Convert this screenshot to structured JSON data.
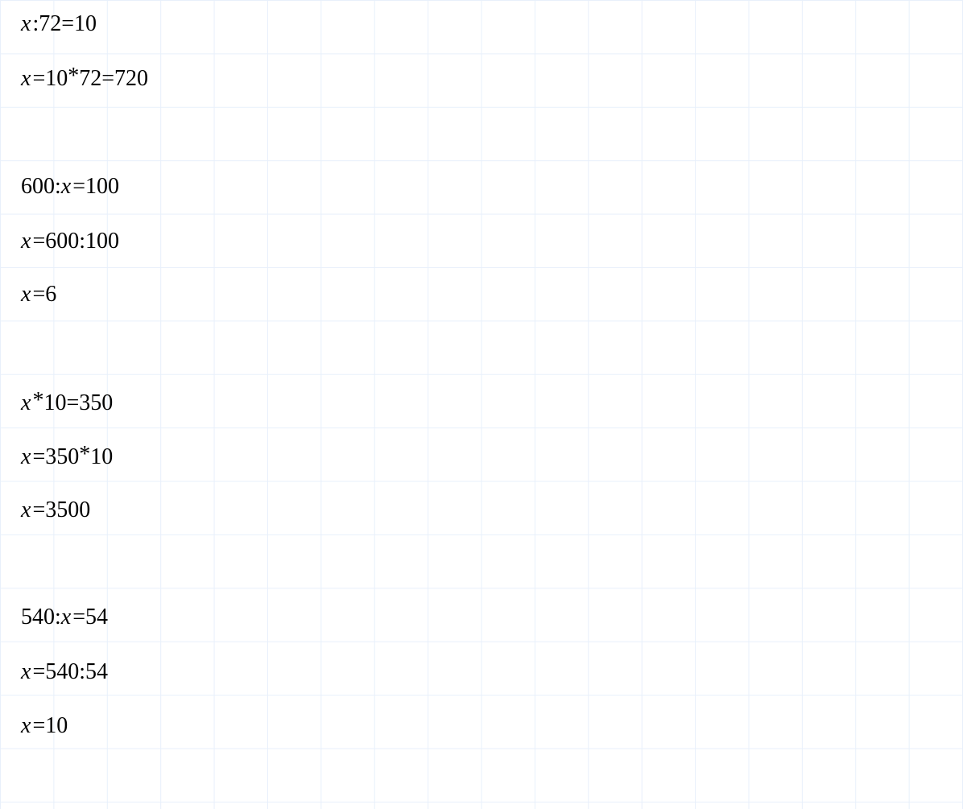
{
  "lines": {
    "l1": "x : 72 = 10",
    "l2": "x = 10 * 72 = 720",
    "l3": "600 : x = 100",
    "l4": "x = 600 : 100",
    "l5": "x = 6",
    "l6": "x * 10 = 350",
    "l7": "x = 350 * 10",
    "l8": "x = 3500",
    "l9": "540 : x = 54",
    "l10": "x = 540 : 54",
    "l11": "x = 10"
  },
  "content": {
    "p1": {
      "eq1": {
        "x": "x",
        "colon": " : ",
        "n1": "72",
        "eq": " = ",
        "n2": "10"
      },
      "eq2": {
        "x": "x",
        "eq1": " = ",
        "n1": "10",
        "star": " * ",
        "n2": "72",
        "eq2": " = ",
        "n3": "720"
      }
    },
    "p2": {
      "eq1": {
        "n1": "600",
        "colon": " : ",
        "x": "x",
        "eq": " = ",
        "n2": "100"
      },
      "eq2": {
        "x": "x",
        "eq": " = ",
        "n1": "600",
        "colon": " : ",
        "n2": "100"
      },
      "eq3": {
        "x": "x",
        "eq": " = ",
        "n1": "6"
      }
    },
    "p3": {
      "eq1": {
        "x": "x",
        "star": " * ",
        "n1": "10",
        "eq": " = ",
        "n2": "350"
      },
      "eq2": {
        "x": "x",
        "eq": " = ",
        "n1": "350",
        "star": " * ",
        "n2": "10"
      },
      "eq3": {
        "x": "x",
        "eq": " = ",
        "n1": "3500"
      }
    },
    "p4": {
      "eq1": {
        "n1": "540",
        "colon": " : ",
        "x": "x",
        "eq": " = ",
        "n2": "54"
      },
      "eq2": {
        "x": "x",
        "eq": " = ",
        "n1": "540",
        "colon": " : ",
        "n2": "54"
      },
      "eq3": {
        "x": "x",
        "eq": " = ",
        "n1": "10"
      }
    }
  }
}
